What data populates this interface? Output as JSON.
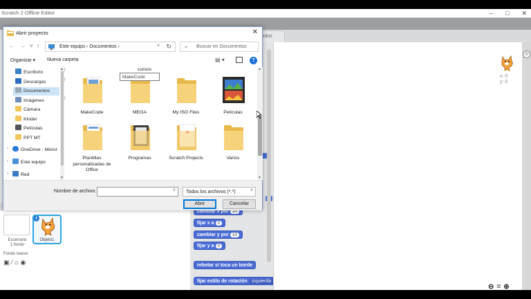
{
  "app": {
    "window_title": "Scratch 2 Offline Editor",
    "tab_label": "onidos",
    "win_controls": [
      "–",
      "□",
      "✕"
    ],
    "coords_x": "x: 0",
    "coords_y": "y: 0",
    "zoom_out": "⊖",
    "zoom_reset": "=",
    "zoom_in": "⊕",
    "right_bar_icon": "⊙"
  },
  "dialog": {
    "title": "Abrir proyecto",
    "close": "✕",
    "nav": {
      "back": "←",
      "forward": "→",
      "recent": "˅",
      "up": "↑",
      "path": "Este equipo  ›  Documentos  ›",
      "path_dropdown": "˅",
      "refresh": "↻",
      "search_placeholder": "Buscar en Documentos",
      "search_icon": "⌕"
    },
    "command_bar": {
      "organize": "Organizar ▾",
      "new_folder": "Nueva carpeta",
      "view_icon": "▤ ▾",
      "help": "?"
    },
    "sidebar": {
      "items": [
        {
          "label": "Escritorio",
          "icon": "desktop-icon",
          "color": "#3b82c4",
          "pinned": true
        },
        {
          "label": "Descargas",
          "icon": "downloads-icon",
          "color": "#2b6cc0",
          "pinned": true
        },
        {
          "label": "Documentos",
          "icon": "documents-icon",
          "color": "#9aa7b4",
          "pinned": true,
          "selected": true
        },
        {
          "label": "Imágenes",
          "icon": "pictures-icon",
          "color": "#6b8fb8",
          "pinned": true
        },
        {
          "label": "Cámara",
          "icon": "folder-icon",
          "color": "#f1c75b"
        },
        {
          "label": "Kinder",
          "icon": "folder-icon",
          "color": "#f1c75b"
        },
        {
          "label": "Películas",
          "icon": "videos-icon",
          "color": "#555555"
        },
        {
          "label": "PPT MT",
          "icon": "folder-icon",
          "color": "#f1c75b"
        },
        {
          "label": "OneDrive - Minist",
          "icon": "onedrive-icon",
          "color": "#2a7bd6"
        },
        {
          "label": "Este equipo",
          "icon": "computer-icon",
          "color": "#4a90d9"
        },
        {
          "label": "Red",
          "icon": "network-icon",
          "color": "#3a7cc4"
        }
      ],
      "pin_glyph": "†",
      "expand_glyph": "›"
    },
    "files": {
      "partial_top_label": "cursos",
      "items": [
        {
          "label": "MakeCode",
          "kind": "folder-doc"
        },
        {
          "label": "MEGA",
          "kind": "folder"
        },
        {
          "label": "My ISO Files",
          "kind": "folder"
        },
        {
          "label": "Películas",
          "kind": "folder-video"
        },
        {
          "label": "Plantillas personalizadas de Office",
          "kind": "folder-doc"
        },
        {
          "label": "Programas",
          "kind": "folder-dark"
        },
        {
          "label": "Scratch Projects",
          "kind": "folder-white"
        },
        {
          "label": "Varios",
          "kind": "folder"
        }
      ],
      "tooltip": "MakeCode"
    },
    "bottom": {
      "filename_label": "Nombre de archivo:",
      "filename_value": "",
      "filetype": "Todos los archivos (*.*)",
      "dropdown_glyph": "˅",
      "open": "Abrir",
      "cancel": "Cancelar"
    }
  },
  "palette": {
    "blocks": [
      {
        "text": "cambiar x por",
        "value": "10"
      },
      {
        "text": "fijar x a",
        "value": "0"
      },
      {
        "text": "cambiar y por",
        "value": "10"
      },
      {
        "text": "fijar y a",
        "value": "0"
      },
      {
        "text": "rebotar si toca un borde"
      },
      {
        "text": "fijar estilo de rotación",
        "dropdown": "izquierda"
      }
    ]
  },
  "sprites": {
    "stage_label_1": "Escenario",
    "stage_label_2": "1 fondo",
    "new_backdrop": "Fondo nuevo:",
    "new_backdrop_icons": [
      "▣",
      "∕",
      "⌂",
      "◉"
    ],
    "sprite_name": "Objeto1",
    "info": "i"
  }
}
